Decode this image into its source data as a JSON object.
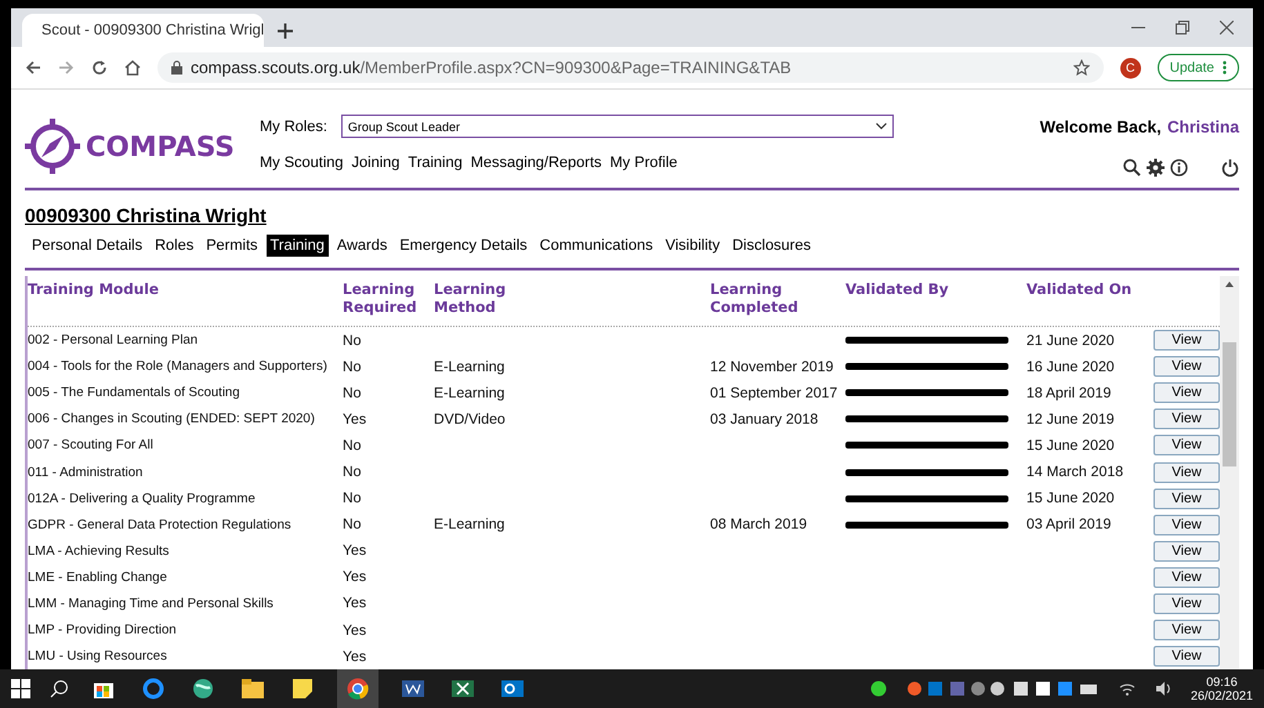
{
  "browser": {
    "tab_title": "Scout - 00909300 Christina Wrigl",
    "url_host": "compass.scouts.org.uk",
    "url_path": "/MemberProfile.aspx?CN=909300&Page=TRAINING&TAB",
    "profile_initial": "C",
    "update_label": "Update"
  },
  "header": {
    "logo": "COMPASS",
    "roles_label": "My Roles:",
    "role_value": "Group Scout Leader",
    "welcome": "Welcome Back,",
    "user": "Christina",
    "nav": [
      "My Scouting",
      "Joining",
      "Training",
      "Messaging/Reports",
      "My Profile"
    ]
  },
  "member_title": "00909300 Christina Wright",
  "tabs": [
    {
      "label": "Personal Details",
      "selected": false
    },
    {
      "label": "Roles",
      "selected": false
    },
    {
      "label": "Permits",
      "selected": false
    },
    {
      "label": "Training",
      "selected": true
    },
    {
      "label": "Awards",
      "selected": false
    },
    {
      "label": "Emergency Details",
      "selected": false
    },
    {
      "label": "Communications",
      "selected": false
    },
    {
      "label": "Visibility",
      "selected": false
    },
    {
      "label": "Disclosures",
      "selected": false
    }
  ],
  "table": {
    "columns": [
      "Training Module",
      "Learning Required",
      "Learning Method",
      "Learning Completed",
      "Validated By",
      "Validated On"
    ],
    "rows": [
      {
        "module": "002 - Personal Learning Plan",
        "required": "No",
        "validated_redacted": true,
        "validated_on": "21 June 2020",
        "action": "View"
      },
      {
        "module": "004 - Tools for the Role (Managers and Supporters)",
        "required": "No",
        "method": "E-Learning",
        "completed": "12 November 2019",
        "validated_redacted": true,
        "validated_on": "16 June 2020",
        "action": "View"
      },
      {
        "module": "005 - The Fundamentals of Scouting",
        "required": "No",
        "method": "E-Learning",
        "completed": "01 September 2017",
        "validated_redacted": true,
        "validated_on": "18 April 2019",
        "action": "View"
      },
      {
        "module": "006 - Changes in Scouting (ENDED: SEPT 2020)",
        "required": "Yes",
        "method": "DVD/Video",
        "completed": "03 January 2018",
        "validated_redacted": true,
        "validated_on": "12 June 2019",
        "action": "View"
      },
      {
        "module": "007 - Scouting For All",
        "required": "No",
        "validated_redacted": true,
        "validated_on": "15 June 2020",
        "action": "View"
      },
      {
        "module": "011 - Administration",
        "required": "No",
        "validated_redacted": true,
        "validated_on": "14 March 2018",
        "action": "View"
      },
      {
        "module": "012A - Delivering a Quality Programme",
        "required": "No",
        "validated_redacted": true,
        "validated_on": "15 June 2020",
        "action": "View"
      },
      {
        "module": "GDPR - General Data Protection Regulations",
        "required": "No",
        "method": "E-Learning",
        "completed": "08 March 2019",
        "validated_redacted": true,
        "validated_on": "03 April 2019",
        "action": "View"
      },
      {
        "module": "LMA - Achieving Results",
        "required": "Yes",
        "action": "View"
      },
      {
        "module": "LME - Enabling Change",
        "required": "Yes",
        "action": "View"
      },
      {
        "module": "LMM - Managing Time and Personal Skills",
        "required": "Yes",
        "action": "View"
      },
      {
        "module": "LMP - Providing Direction",
        "required": "Yes",
        "action": "View"
      },
      {
        "module": "LMU - Using Resources",
        "required": "Yes",
        "action": "View"
      }
    ]
  },
  "taskbar": {
    "time": "09:16",
    "date": "26/02/2021"
  }
}
